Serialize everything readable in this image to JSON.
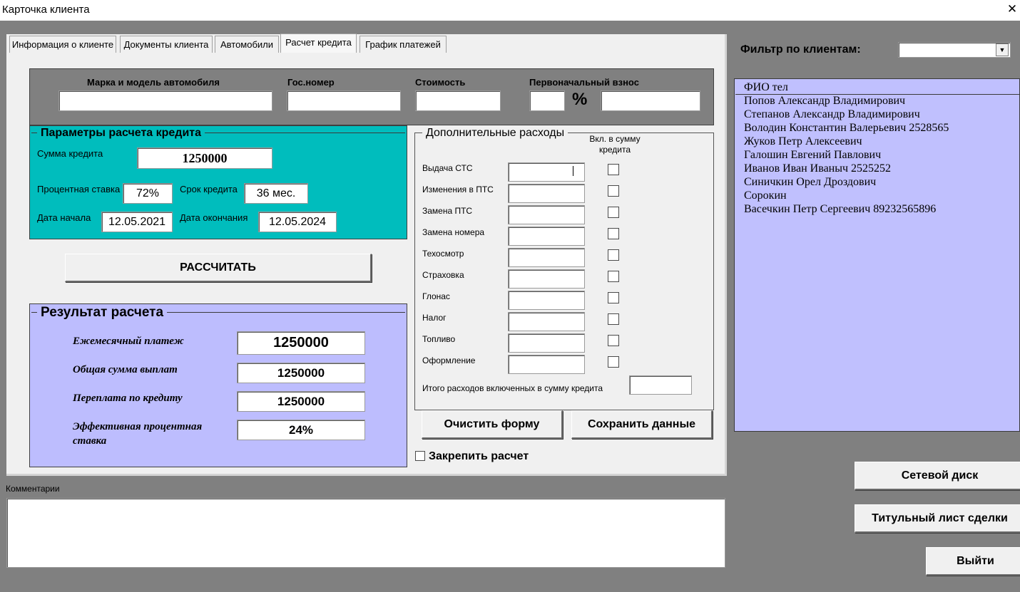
{
  "window": {
    "title": "Карточка клиента",
    "close": "✕"
  },
  "tabs": [
    {
      "label": "Информация о клиенте"
    },
    {
      "label": "Документы клиента"
    },
    {
      "label": "Автомобили"
    },
    {
      "label": "Расчет кредита"
    },
    {
      "label": "График платежей"
    }
  ],
  "car": {
    "model_label": "Марка и модель автомобиля",
    "plate_label": "Гос.номер",
    "cost_label": "Стоимость",
    "down_label": "Первоначальный взнос",
    "percent_sign": "%",
    "model_value": "",
    "plate_value": "",
    "cost_value": "",
    "down_pct_value": "",
    "down_value": ""
  },
  "credit_params": {
    "title": "Параметры расчета кредита",
    "sum_label": "Сумма кредита",
    "sum_value": "1250000",
    "rate_label": "Процентная ставка",
    "rate_value": "72%",
    "term_label": "Срок кредита",
    "term_value": "36 мес.",
    "start_label": "Дата начала",
    "start_value": "12.05.2021",
    "end_label": "Дата окончания",
    "end_value": "12.05.2024"
  },
  "calc_button": "РАССЧИТАТЬ",
  "result": {
    "title": "Результат расчета",
    "monthly_label": "Ежемесячный платеж",
    "monthly_value": "1250000",
    "total_label": "Общая сумма выплат",
    "total_value": "1250000",
    "overpay_label": "Переплата по кредиту",
    "overpay_value": "1250000",
    "eff_label": "Эффективная процентная ставка",
    "eff_value": "24%"
  },
  "extra": {
    "title": "Дополнительные расходы",
    "include_header": "Вкл. в сумму кредита",
    "items": [
      {
        "label": "Выдача СТС"
      },
      {
        "label": "Изменения в ПТС"
      },
      {
        "label": "Замена ПТС"
      },
      {
        "label": "Замена номера"
      },
      {
        "label": "Техосмотр"
      },
      {
        "label": "Страховка"
      },
      {
        "label": "Глонас"
      },
      {
        "label": "Налог"
      },
      {
        "label": "Топливо"
      },
      {
        "label": "Оформление"
      }
    ],
    "total_label": "Итого расходов включенных в сумму кредита",
    "total_value": ""
  },
  "actions": {
    "clear": "Очистить форму",
    "save": "Сохранить данные",
    "pin": "Закрепить расчет"
  },
  "comments": {
    "label": "Комментарии",
    "value": ""
  },
  "filter": {
    "label": "Фильтр по клиентам:",
    "value": ""
  },
  "clients": {
    "header": "ФИО  тел",
    "items": [
      "Попов Александр Владимирович",
      "Степанов Александр Владимирович",
      "Володин Константин Валерьевич 2528565",
      "Жуков Петр Алексеевич",
      "Галошин Евгений Павлович",
      "Иванов Иван Иваныч 2525252",
      "Синичкин Орел Дроздович",
      "Сорокин",
      "Васечкин Петр Сергеевич 89232565896"
    ]
  },
  "side_buttons": {
    "network": "Сетевой диск",
    "title_page": "Титульный лист сделки",
    "exit": "Выйти"
  },
  "colors": {
    "params_bg": "#00bdbd",
    "result_bg": "#bdbdfe",
    "clients_bg": "#c0c0fe",
    "page_bg": "#f0f0f0",
    "outer_bg": "#808080"
  }
}
